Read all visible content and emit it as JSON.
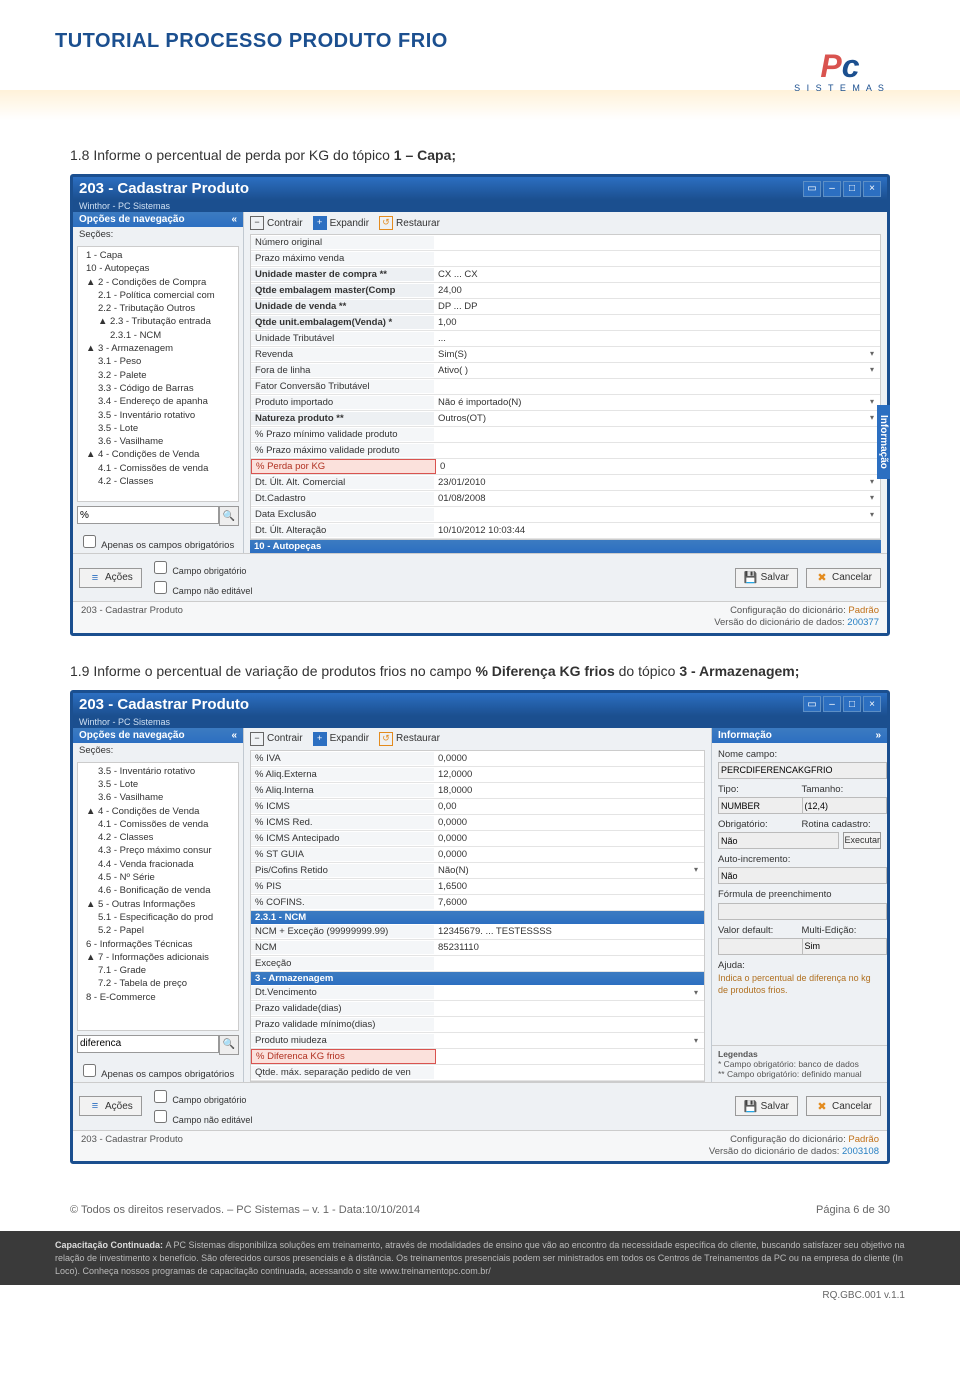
{
  "header": {
    "title": "TUTORIAL PROCESSO PRODUTO FRIO",
    "logo_top": "PC",
    "logo_bottom": "S I S T E M A S"
  },
  "step1": {
    "prefix": "1.8 Informe o percentual de perda por KG do tópico ",
    "bold": "1 – Capa;"
  },
  "step2": {
    "prefix": "1.9 Informe o percentual de variação de produtos frios no campo ",
    "bold1": "% Diferença KG frios",
    "mid": " do tópico ",
    "bold2": "3 - Armazenagem;"
  },
  "app1": {
    "title": "203 - Cadastrar Produto",
    "subtitle": "Winthor - PC Sistemas",
    "nav_title": "Opções de navegação",
    "sections_label": "Seções:",
    "tree": [
      {
        "l": 1,
        "t": "1 - Capa"
      },
      {
        "l": 1,
        "t": "10 - Autopeças"
      },
      {
        "l": 1,
        "t": "▲ 2 - Condições de Compra"
      },
      {
        "l": 2,
        "t": "2.1 - Política comercial com"
      },
      {
        "l": 2,
        "t": "2.2 - Tributação Outros"
      },
      {
        "l": 2,
        "t": "▲ 2.3 - Tributação entrada"
      },
      {
        "l": 3,
        "t": "2.3.1 - NCM"
      },
      {
        "l": 1,
        "t": "▲ 3 - Armazenagem"
      },
      {
        "l": 2,
        "t": "3.1 - Peso"
      },
      {
        "l": 2,
        "t": "3.2 - Palete"
      },
      {
        "l": 2,
        "t": "3.3 - Código de Barras"
      },
      {
        "l": 2,
        "t": "3.4 - Endereço de apanha"
      },
      {
        "l": 2,
        "t": "3.5 - Inventário rotativo"
      },
      {
        "l": 2,
        "t": "3.5 - Lote"
      },
      {
        "l": 2,
        "t": "3.6 - Vasilhame"
      },
      {
        "l": 1,
        "t": "▲ 4 - Condições de Venda"
      },
      {
        "l": 2,
        "t": "4.1 - Comissões de venda"
      },
      {
        "l": 2,
        "t": "4.2 - Classes"
      }
    ],
    "search_value": "%",
    "chk_only": "Apenas os campos obrigatórios",
    "toolbar": {
      "contrair": "Contrair",
      "expandir": "Expandir",
      "restaurar": "Restaurar"
    },
    "rows": [
      {
        "label": "Número original",
        "val": "",
        "bold": false
      },
      {
        "label": "Prazo máximo venda",
        "val": "",
        "bold": false
      },
      {
        "label": "Unidade master de compra **",
        "val": "CX ... CX",
        "bold": true
      },
      {
        "label": "Qtde embalagem master(Comp",
        "val": "24,00",
        "bold": true
      },
      {
        "label": "Unidade de venda **",
        "val": "DP ... DP",
        "bold": true
      },
      {
        "label": "Qtde unit.embalagem(Venda) *",
        "val": "1,00",
        "bold": true
      },
      {
        "label": "Unidade Tributável",
        "val": "...",
        "bold": false
      },
      {
        "label": "Revenda",
        "val": "Sim(S)",
        "bold": false,
        "dd": true
      },
      {
        "label": "Fora de linha",
        "val": "Ativo( )",
        "bold": false,
        "dd": true
      },
      {
        "label": "Fator Conversão Tributável",
        "val": "",
        "bold": false
      },
      {
        "label": "Produto importado",
        "val": "Não é importado(N)",
        "bold": false,
        "dd": true
      },
      {
        "label": "Natureza produto **",
        "val": "Outros(OT)",
        "bold": true,
        "dd": true
      },
      {
        "label": "% Prazo mínimo validade produto",
        "val": "",
        "bold": false
      },
      {
        "label": "% Prazo máximo validade produto",
        "val": "",
        "bold": false
      },
      {
        "label": "% Perda por KG",
        "val": "0",
        "bold": false,
        "hl": true
      },
      {
        "label": "Dt. Últ. Alt. Comercial",
        "val": "23/01/2010",
        "bold": false,
        "dd": true
      },
      {
        "label": "Dt.Cadastro",
        "val": "01/08/2008",
        "bold": false,
        "dd": true
      },
      {
        "label": "Data Exclusão",
        "val": "",
        "bold": false,
        "dd": true
      },
      {
        "label": "Dt. Últ. Alteração",
        "val": "10/10/2012 10:03:44",
        "bold": false
      }
    ],
    "section2": "10 - Autopeças",
    "side_tab": "Informação",
    "actions": "Ações",
    "chk1": "Campo obrigatório",
    "chk2": "Campo não editável",
    "save": "Salvar",
    "cancel": "Cancelar",
    "status_left": "203 - Cadastrar Produto",
    "status_r1": "Configuração do dicionário: ",
    "status_r1v": "Padrão",
    "status_r2": "Versão do dicionário de dados: ",
    "status_r2v": "200377"
  },
  "app2": {
    "title": "203 - Cadastrar Produto",
    "subtitle": "Winthor - PC Sistemas",
    "nav_title": "Opções de navegação",
    "sections_label": "Seções:",
    "tree": [
      {
        "l": 2,
        "t": "3.5 - Inventário rotativo"
      },
      {
        "l": 2,
        "t": "3.5 - Lote"
      },
      {
        "l": 2,
        "t": "3.6 - Vasilhame"
      },
      {
        "l": 1,
        "t": "▲ 4 - Condições de Venda"
      },
      {
        "l": 2,
        "t": "4.1 - Comissões de venda"
      },
      {
        "l": 2,
        "t": "4.2 - Classes"
      },
      {
        "l": 2,
        "t": "4.3 - Preço máximo consur"
      },
      {
        "l": 2,
        "t": "4.4 - Venda fracionada"
      },
      {
        "l": 2,
        "t": "4.5 - Nº Série"
      },
      {
        "l": 2,
        "t": "4.6 - Bonificação de venda"
      },
      {
        "l": 1,
        "t": "▲ 5 - Outras Informações"
      },
      {
        "l": 2,
        "t": "5.1 - Especificação do prod"
      },
      {
        "l": 2,
        "t": "5.2 - Papel"
      },
      {
        "l": 1,
        "t": "6 - Informações Técnicas"
      },
      {
        "l": 1,
        "t": "▲ 7 - Informações adicionais"
      },
      {
        "l": 2,
        "t": "7.1 - Grade"
      },
      {
        "l": 2,
        "t": "7.2 - Tabela de preço"
      },
      {
        "l": 1,
        "t": "8 - E-Commerce"
      }
    ],
    "search_value": "diferenca",
    "chk_only": "Apenas os campos obrigatórios",
    "toolbar": {
      "contrair": "Contrair",
      "expandir": "Expandir",
      "restaurar": "Restaurar"
    },
    "rows": [
      {
        "label": "% IVA",
        "val": "0,0000"
      },
      {
        "label": "% Aliq.Externa",
        "val": "12,0000"
      },
      {
        "label": "% Aliq.Interna",
        "val": "18,0000"
      },
      {
        "label": "% ICMS",
        "val": "0,00"
      },
      {
        "label": "% ICMS Red.",
        "val": "0,0000"
      },
      {
        "label": "% ICMS Antecipado",
        "val": "0,0000"
      },
      {
        "label": "% ST GUIA",
        "val": "0,0000"
      },
      {
        "label": "Pis/Cofins Retido",
        "val": "Não(N)",
        "dd": true
      },
      {
        "label": "% PIS",
        "val": "1,6500"
      },
      {
        "label": "% COFINS.",
        "val": "7,6000"
      }
    ],
    "section_ncm": "2.3.1 - NCM",
    "rows_ncm": [
      {
        "label": "NCM + Exceção (99999999.99)",
        "val": "12345679. ... TESTESSSS"
      },
      {
        "label": "NCM",
        "val": "85231110"
      },
      {
        "label": "Exceção",
        "val": ""
      }
    ],
    "section_arm": "3 - Armazenagem",
    "rows_arm": [
      {
        "label": "Dt.Vencimento",
        "val": "",
        "dd": true
      },
      {
        "label": "Prazo validade(dias)",
        "val": ""
      },
      {
        "label": "Prazo validade mínimo(dias)",
        "val": ""
      },
      {
        "label": "Produto miudeza",
        "val": "",
        "dd": true
      },
      {
        "label": "% Diferenca KG frios",
        "val": "",
        "hl": true
      },
      {
        "label": "Qtde. máx. separação pedido de ven",
        "val": ""
      }
    ],
    "info": {
      "title": "Informação",
      "nome_campo_l": "Nome campo:",
      "nome_campo": "PERCDIFERENCAKGFRIO",
      "tipo_l": "Tipo:",
      "tipo": "NUMBER",
      "tamanho_l": "Tamanho:",
      "tamanho": "(12,4)",
      "obrig_l": "Obrigatório:",
      "obrig_v": "Rotina cadastro:",
      "nao": "Não",
      "exec": "Executar",
      "autoinc_l": "Auto-incremento:",
      "autoinc": "Não",
      "formula_l": "Fórmula de preenchimento",
      "vdef_l": "Valor default:",
      "multi_l": "Multi-Edição:",
      "multi": "Sim",
      "ajuda_l": "Ajuda:",
      "ajuda": "Indica o percentual de diferença no kg de produtos frios.",
      "leg_title": "Legendas",
      "leg1": "* Campo obrigatório: banco de dados",
      "leg2": "** Campo obrigatório: definido manual"
    },
    "actions": "Ações",
    "chk1": "Campo obrigatório",
    "chk2": "Campo não editável",
    "save": "Salvar",
    "cancel": "Cancelar",
    "status_left": "203 - Cadastrar Produto",
    "status_r1": "Configuração do dicionário: ",
    "status_r1v": "Padrão",
    "status_r2": "Versão do dicionário de dados: ",
    "status_r2v": "2003108"
  },
  "page_footer": {
    "left": "© Todos os direitos reservados. – PC Sistemas – v. 1 - Data:10/10/2014",
    "right": "Página 6 de 30"
  },
  "dark_footer": {
    "bold": "Capacitação Continuada: ",
    "text": "A PC Sistemas disponibiliza soluções em treinamento, através de modalidades de ensino que vão ao encontro da necessidade específica do cliente, buscando satisfazer seu objetivo na relação de investimento x benefício. São oferecidos cursos presenciais e à distância. Os treinamentos presenciais podem ser ministrados em todos os Centros de Treinamentos da PC ou na empresa do cliente (In Loco). Conheça nossos programas de capacitação continuada, acessando o site www.treinamentopc.com.br/"
  },
  "rq": "RQ.GBC.001 v.1.1"
}
